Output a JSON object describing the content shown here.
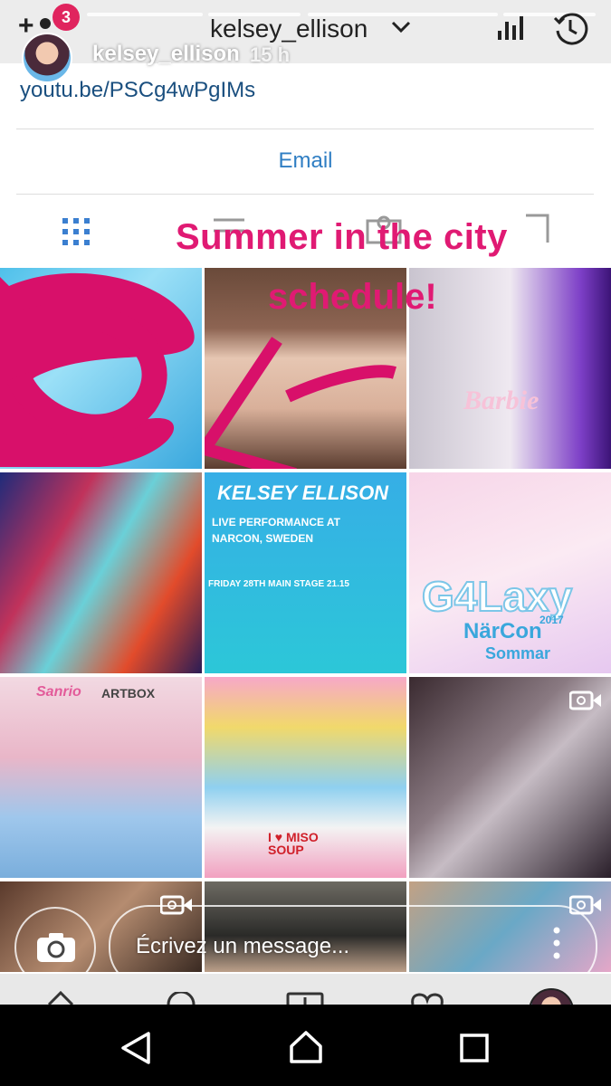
{
  "header": {
    "username": "kelsey_ellison",
    "notification_count": "3",
    "add_label": "+"
  },
  "story": {
    "author": "kelsey_ellison",
    "time": "15 h",
    "overlay_line1": "Summer in the city",
    "overlay_line2": "schedule!"
  },
  "profile": {
    "link": "youtu.be/PSCg4wPgIMs",
    "email_button": "Email"
  },
  "posts": {
    "tile4_caption_title": "KELSEY ELLISON",
    "tile4_caption_body1": "LIVE PERFORMANCE AT",
    "tile4_caption_body2": "NARCON, SWEDEN",
    "tile4_caption_footer": "FRIDAY 28TH  MAIN STAGE 21.15",
    "tile5_caption": "G4Laxy",
    "tile5_sub1": "NärCon",
    "tile5_sub2": "Sommar",
    "tile5_year": "2017",
    "tile6_caption": "Sanrio",
    "tile6_caption2": "ARTBOX",
    "tile7_sign": "I ♥ MISO SOUP",
    "tile3_shirt": "Barbie"
  },
  "message": {
    "placeholder": "Écrivez un message..."
  },
  "colors": {
    "accent_pink": "#e01a73",
    "link_blue": "#2f7ec3"
  }
}
